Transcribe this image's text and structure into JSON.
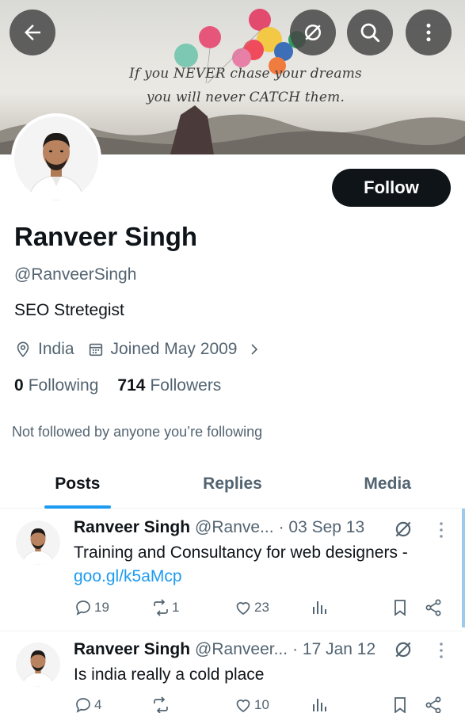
{
  "banner": {
    "quote_line1": "If you NEVER chase your dreams",
    "quote_line2": "you will never CATCH them."
  },
  "profile": {
    "name": "Ranveer Singh",
    "handle": "@RanveerSingh",
    "bio": "SEO Stretegist",
    "location": "India",
    "joined": "Joined May 2009",
    "following_count": "0",
    "following_label": "Following",
    "followers_count": "714",
    "followers_label": "Followers",
    "not_followed_text": "Not followed by anyone you’re following",
    "follow_label": "Follow"
  },
  "tabs": [
    {
      "label": "Posts",
      "active": true
    },
    {
      "label": "Replies",
      "active": false
    },
    {
      "label": "Media",
      "active": false
    }
  ],
  "posts": [
    {
      "name": "Ranveer Singh",
      "handle": "@Ranve...",
      "date": "· 03 Sep 13",
      "text": "Training and Consultancy for web designers -",
      "link": "goo.gl/k5aMcp",
      "replies": "19",
      "reposts": "1",
      "likes": "23"
    },
    {
      "name": "Ranveer Singh",
      "handle": "@Ranveer...",
      "date": "· 17 Jan 12",
      "text": "Is india really a cold place",
      "replies": "4",
      "reposts": "",
      "likes": "10"
    }
  ],
  "colors": {
    "accent": "#1d9bf0",
    "text_primary": "#0f1419",
    "text_secondary": "#536471",
    "follow_bg": "#0f1419"
  },
  "icons": [
    "back-arrow-icon",
    "grok-icon",
    "search-icon",
    "more-vertical-icon",
    "location-icon",
    "calendar-icon",
    "chevron-right-icon",
    "reply-icon",
    "repost-icon",
    "like-icon",
    "views-icon",
    "bookmark-icon",
    "share-icon"
  ]
}
